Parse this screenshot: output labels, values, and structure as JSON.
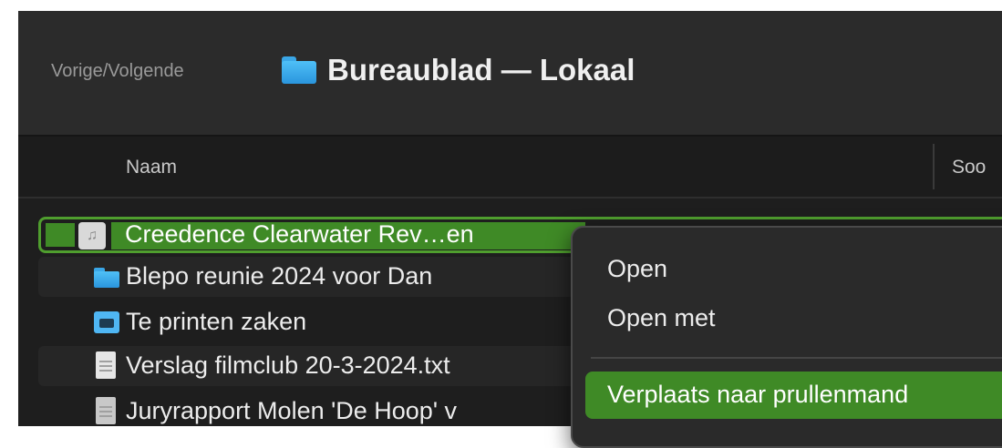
{
  "toolbar": {
    "nav_label": "Vorige/Volgende",
    "title": "Bureaublad — Lokaal",
    "title_icon": "folder-icon"
  },
  "columns": {
    "name": "Naam",
    "kind": "Soo"
  },
  "files": [
    {
      "name": "Creedence Clearwater Rev…en",
      "icon": "audio-file-icon",
      "selected": true
    },
    {
      "name": "Blepo reunie 2024 voor Dan",
      "icon": "folder-icon"
    },
    {
      "name": "Te printen zaken",
      "icon": "printer-folder-icon"
    },
    {
      "name": "Verslag filmclub 20-3-2024.txt",
      "icon": "text-document-icon"
    },
    {
      "name": "Juryrapport Molen 'De Hoop' v",
      "icon": "document-icon"
    }
  ],
  "context_menu": {
    "items": [
      "Open",
      "Open met",
      "Verplaats naar prullenmand"
    ],
    "highlighted": "Verplaats naar prullenmand"
  },
  "colors": {
    "selection": "#3f8a26",
    "background": "#1e1e1e",
    "folder": "#3aa6e6"
  }
}
